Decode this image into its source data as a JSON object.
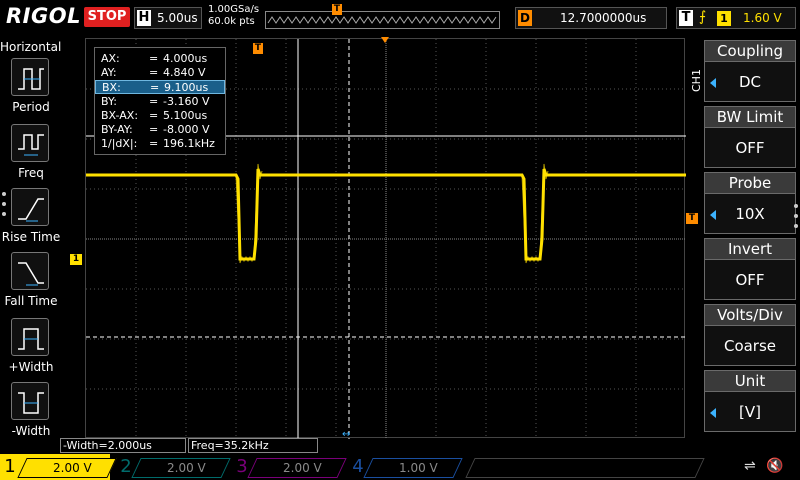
{
  "topbar": {
    "logo": "RIGOL",
    "run_state": "STOP",
    "horizontal_label": "H",
    "timebase": "5.00us",
    "sample_rate": "1.00GSa/s",
    "memory_depth": "60.0k pts",
    "delay_label": "D",
    "delay": "12.7000000us",
    "trigger_label": "T",
    "trigger_edge": "rising-edge-icon",
    "trigger_source": "1",
    "trigger_level": "1.60 V",
    "trigger_pos_marker": "T"
  },
  "left_menu": {
    "title": "Horizontal",
    "items": [
      {
        "label": "Period",
        "icon": "period-icon"
      },
      {
        "label": "Freq",
        "icon": "freq-icon"
      },
      {
        "label": "Rise Time",
        "icon": "rise-time-icon"
      },
      {
        "label": "Fall Time",
        "icon": "fall-time-icon"
      },
      {
        "label": "+Width",
        "icon": "plus-width-icon"
      },
      {
        "label": "-Width",
        "icon": "minus-width-icon"
      }
    ]
  },
  "cursor_readout": {
    "rows": [
      {
        "key": "AX:",
        "value": "4.000us"
      },
      {
        "key": "AY:",
        "value": "4.840 V"
      },
      {
        "key": "BX:",
        "value": "9.100us"
      },
      {
        "key": "BY:",
        "value": "-3.160 V"
      },
      {
        "key": "BX-AX:",
        "value": "5.100us"
      },
      {
        "key": "BY-AY:",
        "value": "-8.000 V"
      },
      {
        "key": "1/|dX|:",
        "value": "196.1kHz"
      }
    ],
    "selected": "BX:",
    "eq": "="
  },
  "markers": {
    "trigger_top": "T",
    "ch1": "1",
    "trigger_level": "T",
    "time_cursor": "↔"
  },
  "measurements": {
    "neg_width": "-Width=2.000us",
    "freq": "Freq=35.2kHz"
  },
  "right_menu": {
    "channel": "CH1",
    "items": [
      {
        "title": "Coupling",
        "value": "DC",
        "arrow": true
      },
      {
        "title": "BW Limit",
        "value": "OFF",
        "arrow": false
      },
      {
        "title": "Probe",
        "value": "10X",
        "arrow": true
      },
      {
        "title": "Invert",
        "value": "OFF",
        "arrow": false
      },
      {
        "title": "Volts/Div",
        "value": "Coarse",
        "arrow": false
      },
      {
        "title": "Unit",
        "value": "[V]",
        "arrow": true
      }
    ]
  },
  "channels": [
    {
      "num": "1",
      "scale": "2.00 V",
      "color": "#ffe000",
      "active": true
    },
    {
      "num": "2",
      "scale": "2.00 V",
      "color": "#00a0a0",
      "active": false
    },
    {
      "num": "3",
      "scale": "2.00 V",
      "color": "#c000c0",
      "active": false
    },
    {
      "num": "4",
      "scale": "1.00 V",
      "color": "#1a6fd6",
      "active": false
    }
  ],
  "status_icons": {
    "usb": "usb-icon",
    "speaker": "speaker-muted-icon"
  }
}
